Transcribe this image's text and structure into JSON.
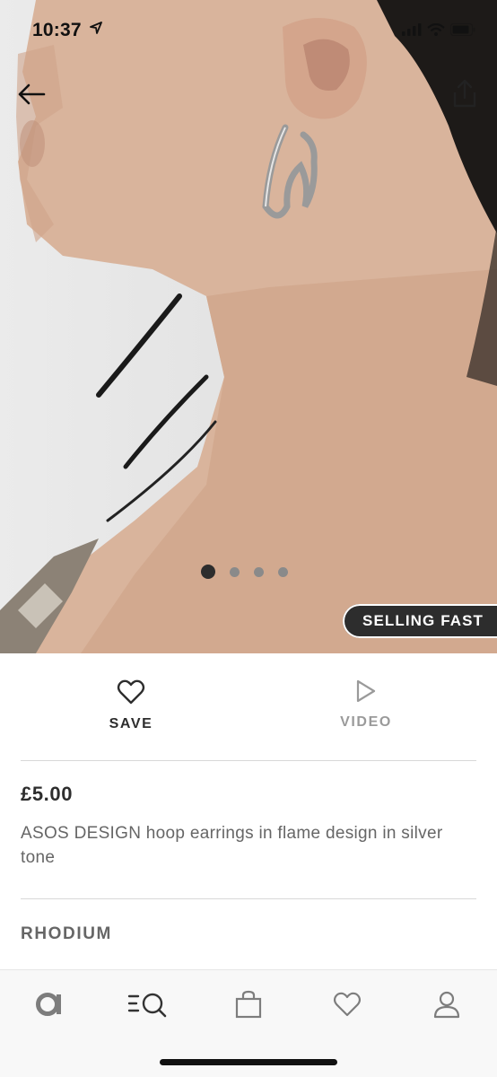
{
  "status_bar": {
    "time": "10:37"
  },
  "hero": {
    "badge": "SELLING FAST",
    "gallery": {
      "count": 4,
      "active_index": 0
    }
  },
  "actions": {
    "save_label": "SAVE",
    "video_label": "VIDEO"
  },
  "product": {
    "price": "£5.00",
    "title": "ASOS DESIGN hoop earrings in flame design in silver tone",
    "colour": "RHODIUM"
  },
  "icons": {
    "back": "back-arrow-icon",
    "share": "share-icon",
    "save": "heart-icon",
    "video": "play-icon",
    "tabs": [
      "asos-home-icon",
      "search-icon",
      "bag-icon",
      "heart-icon",
      "profile-icon"
    ]
  },
  "colors": {
    "text_dark": "#2d2d2d",
    "text_grey": "#666666",
    "muted": "#9a9a9a",
    "badge_bg": "#2d2d2d"
  }
}
